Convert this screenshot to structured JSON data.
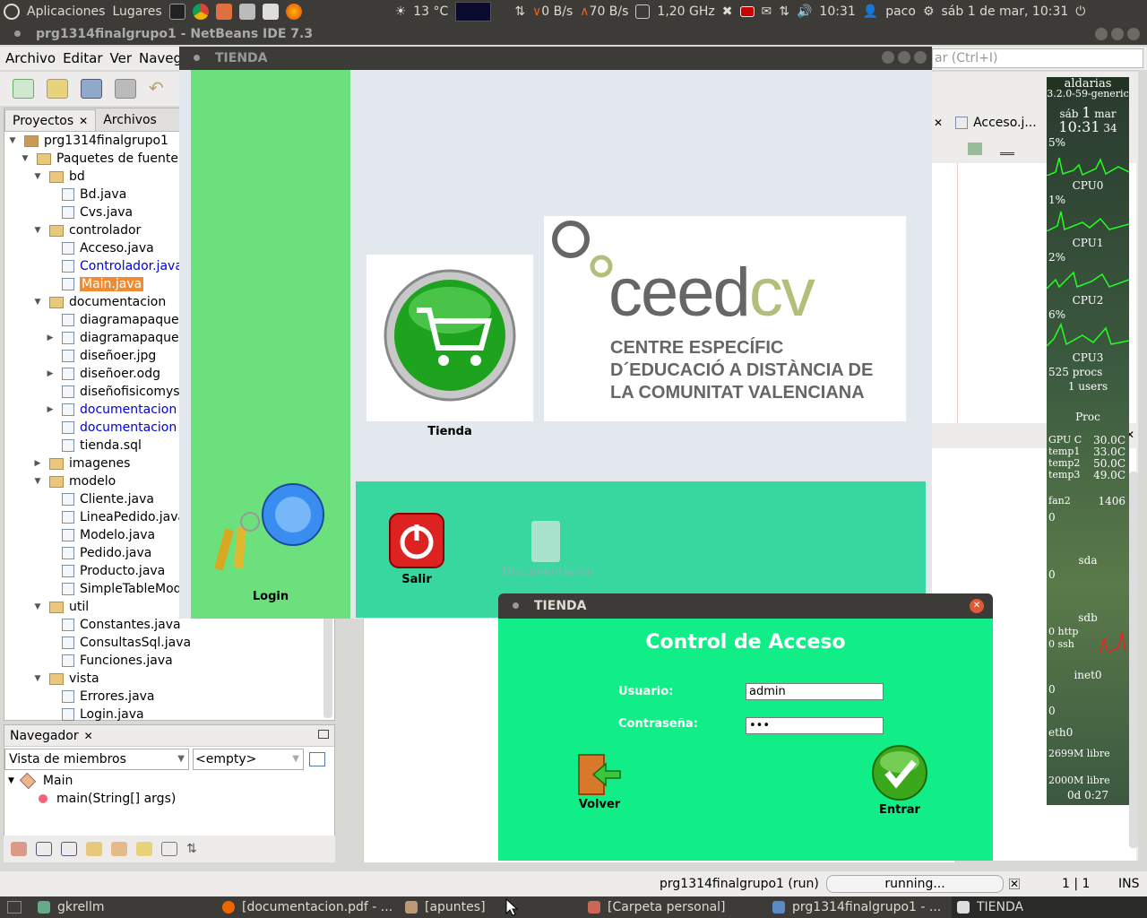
{
  "top_panel": {
    "menu_apps": "Aplicaciones",
    "menu_places": "Lugares",
    "weather": "13 °C",
    "net_down": "0 B/s",
    "net_up": "70 B/s",
    "cpu_freq": "1,20 GHz",
    "clock": "10:31",
    "user": "paco",
    "datetime": "sáb 1 de mar, 10:31"
  },
  "netbeans": {
    "title": "prg1314finalgrupo1 - NetBeans IDE 7.3",
    "menu": [
      "Archivo",
      "Editar",
      "Ver",
      "Naveg"
    ],
    "search_placeholder": "ar (Ctrl+I)",
    "tabs": {
      "projects": "Proyectos",
      "files": "Archivos"
    },
    "editor_tab": "Acceso.j...",
    "tree": [
      {
        "label": "prg1314finalgrupo1",
        "kind": "project"
      },
      {
        "label": "Paquetes de fuente",
        "kind": "source"
      },
      {
        "label": "bd",
        "kind": "package"
      },
      {
        "label": "Bd.java",
        "kind": "file"
      },
      {
        "label": "Cvs.java",
        "kind": "file"
      },
      {
        "label": "controlador",
        "kind": "package"
      },
      {
        "label": "Acceso.java",
        "kind": "file"
      },
      {
        "label": "Controlador.java",
        "kind": "file",
        "style": "blue"
      },
      {
        "label": "Main.java",
        "kind": "file",
        "style": "selected"
      },
      {
        "label": "documentacion",
        "kind": "package"
      },
      {
        "label": "diagramapaquet",
        "kind": "file"
      },
      {
        "label": "diagramapaquet",
        "kind": "file"
      },
      {
        "label": "diseñoer.jpg",
        "kind": "file"
      },
      {
        "label": "diseñoer.odg",
        "kind": "file"
      },
      {
        "label": "diseñofisicomys",
        "kind": "file"
      },
      {
        "label": "documentacion",
        "kind": "file",
        "style": "blue"
      },
      {
        "label": "documentacion",
        "kind": "file",
        "style": "blue"
      },
      {
        "label": "tienda.sql",
        "kind": "file"
      },
      {
        "label": "imagenes",
        "kind": "package"
      },
      {
        "label": "modelo",
        "kind": "package"
      },
      {
        "label": "Cliente.java",
        "kind": "file"
      },
      {
        "label": "LineaPedido.java",
        "kind": "file"
      },
      {
        "label": "Modelo.java",
        "kind": "file"
      },
      {
        "label": "Pedido.java",
        "kind": "file"
      },
      {
        "label": "Producto.java",
        "kind": "file"
      },
      {
        "label": "SimpleTableMod",
        "kind": "file"
      },
      {
        "label": "util",
        "kind": "package"
      },
      {
        "label": "Constantes.java",
        "kind": "file"
      },
      {
        "label": "ConsultasSql.java",
        "kind": "file"
      },
      {
        "label": "Funciones.java",
        "kind": "file"
      },
      {
        "label": "vista",
        "kind": "package"
      },
      {
        "label": "Errores.java",
        "kind": "file"
      },
      {
        "label": "Login.java",
        "kind": "file"
      }
    ],
    "navigator": {
      "title": "Navegador",
      "view_select": "Vista de miembros",
      "filter_select": "<empty>",
      "class_name": "Main",
      "method": "main(String[] args)"
    },
    "status": {
      "project": "prg1314finalgrupo1 (run)",
      "progress": "running...",
      "position": "1 | 1",
      "mode": "INS"
    }
  },
  "gkrellm": {
    "host": "aldarias",
    "kernel": "3.2.0-59-generic",
    "date_day": "sáb",
    "date_num": "1",
    "date_month": "mar",
    "time": "10:31",
    "seconds": "34",
    "cpu_total": "5%",
    "cpu0_label": "CPU0",
    "cpu0": "1%",
    "cpu1_label": "CPU1",
    "cpu1": "2%",
    "cpu2_label": "CPU2",
    "cpu2": "6%",
    "cpu3_label": "CPU3",
    "procs": "525 procs",
    "users": "1 users",
    "proc_label": "Proc",
    "gpu_label": "GPU C",
    "gpu": "30.0C",
    "temp1_label": "temp1",
    "temp1": "33.0C",
    "temp2_label": "temp2",
    "temp2": "50.0C",
    "temp3_label": "temp3",
    "temp3": "49.0C",
    "fan_label": "fan2",
    "fan": "1406",
    "zero": "0",
    "sda": "sda",
    "sdb": "sdb",
    "http": "0 http",
    "ssh": "0 ssh",
    "inet": "inet0",
    "eth": "eth0",
    "mem": "2699M libre",
    "swap": "2000M libre",
    "uptime": "0d  0:27"
  },
  "tienda": {
    "title": "TIENDA",
    "store_button": "Tienda",
    "login_label": "Login",
    "exit_label": "Salir",
    "docs_label": "Documentación",
    "logo": {
      "brand_ceed": "ceed",
      "brand_cv": "cv",
      "line1": "CENTRE ESPECÍFIC",
      "line2": "D´EDUCACIÓ A DISTÀNCIA DE",
      "line3": "LA COMUNITAT VALENCIANA"
    }
  },
  "login_dialog": {
    "title": "TIENDA",
    "heading": "Control de Acceso",
    "user_label": "Usuario:",
    "user_value": "admin",
    "pass_label": "Contraseña:",
    "pass_value": "•••",
    "back_label": "Volver",
    "enter_label": "Entrar"
  },
  "taskbar": [
    {
      "label": "gkrellm"
    },
    {
      "label": "[documentacion.pdf - ..."
    },
    {
      "label": "[apuntes]"
    },
    {
      "label": "[Carpeta personal]"
    },
    {
      "label": "prg1314finalgrupo1 - ..."
    },
    {
      "label": "TIENDA"
    }
  ],
  "colors": {
    "ubuntu_panel": "#3c3b37",
    "tienda_side": "#6de07e",
    "tienda_teal": "#39d7a0",
    "dialog_green": "#11ee88",
    "selection": "#f08a33"
  }
}
